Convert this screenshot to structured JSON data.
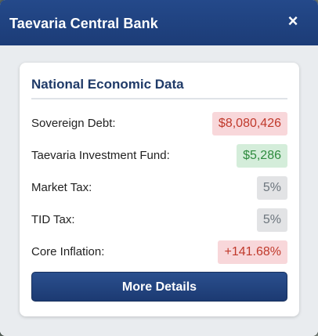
{
  "window": {
    "title": "Taevaria Central Bank",
    "close_symbol": "×"
  },
  "card": {
    "title": "National Economic Data",
    "rows": [
      {
        "label": "Sovereign Debt:",
        "value": "$8,080,426",
        "status": "negative"
      },
      {
        "label": "Taevaria Investment Fund:",
        "value": "$5,286",
        "status": "positive"
      },
      {
        "label": "Market Tax:",
        "value": "5%",
        "status": "neutral"
      },
      {
        "label": "TID Tax:",
        "value": "5%",
        "status": "neutral"
      },
      {
        "label": "Core Inflation:",
        "value": "+141.68%",
        "status": "negative"
      }
    ],
    "button_label": "More Details"
  },
  "colors": {
    "header": "#1f3f7d",
    "negative_bg": "#f8d7da",
    "negative_text": "#c0392b",
    "positive_bg": "#d4edda",
    "positive_text": "#2e8b3e",
    "neutral_bg": "#e2e3e5",
    "neutral_text": "#6c757d"
  }
}
